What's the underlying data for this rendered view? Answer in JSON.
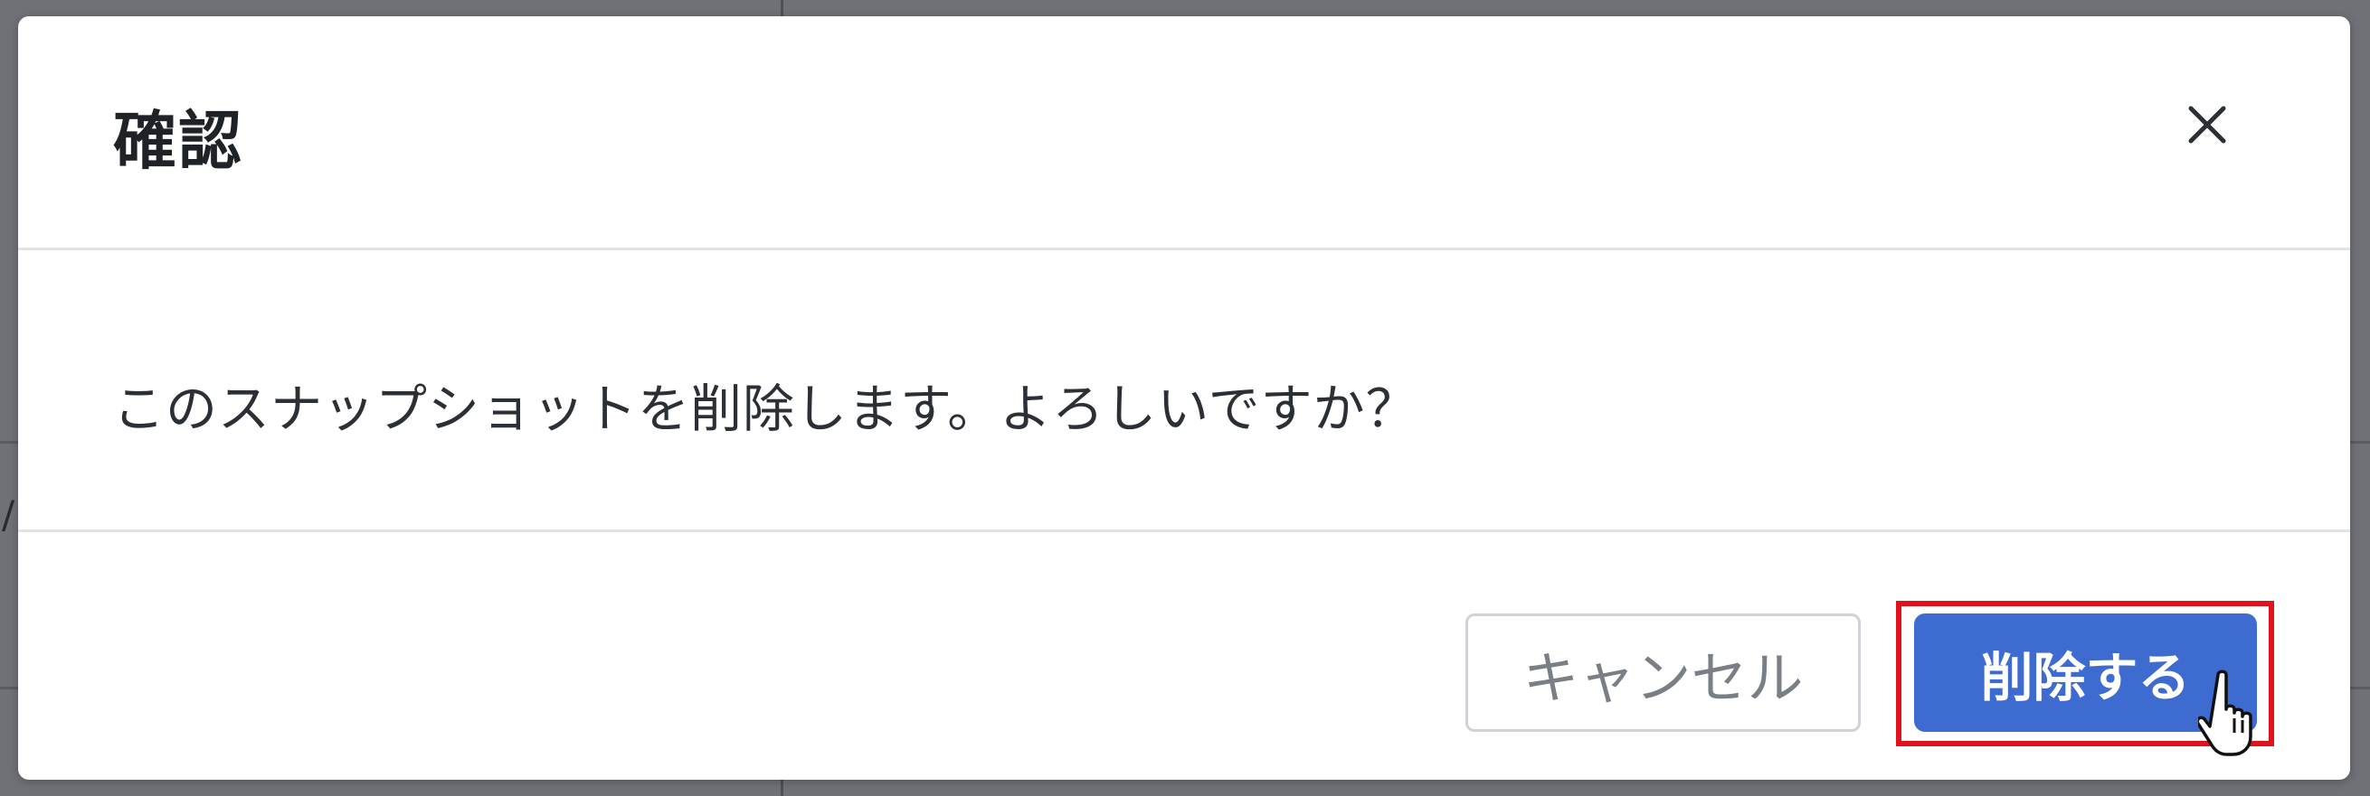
{
  "dialog": {
    "title": "確認",
    "close_icon": "close-icon",
    "message": "このスナップショットを削除します。よろしいですか？"
  },
  "footer": {
    "cancel_label": "キャンセル",
    "confirm_label": "削除する"
  },
  "background": {
    "fragment_text": "/."
  },
  "colors": {
    "primary": "#3e6bcf",
    "highlight": "#e0131c",
    "overlay": "#6f7177"
  },
  "cursor_icon": "hand-pointer-icon"
}
